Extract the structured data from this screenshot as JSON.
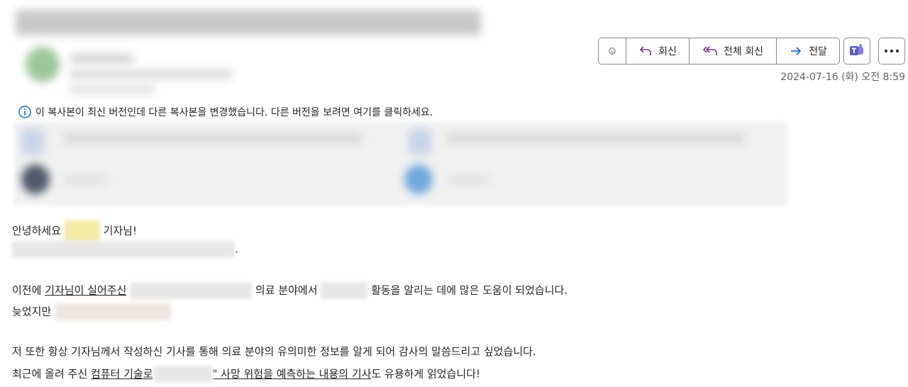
{
  "toolbar": {
    "reply_label": "회신",
    "reply_all_label": "전체 회신",
    "forward_label": "전달"
  },
  "message": {
    "date": "2024-07-16 (화) 오전 8:59",
    "info_text": "이 복사본이 최신 버전인데 다른 복사본을 변경했습니다. 다른 버전을 보려면 여기를 클릭하세요."
  },
  "body": {
    "greeting_prefix": "안녕하세요",
    "greeting_suffix": "기자님!",
    "line2_end": ".",
    "p1_a": "이전에",
    "p1_link": "기자님이 실어주신",
    "p1_b": "의료 분야에서",
    "p1_c": "활동을 알리는 데에 많은 도움이 되었습니다.",
    "p2_a": "늦었지만",
    "p3": "저 또한 항상 기자님께서 작성하신 기사를 통해 의료 분야의 유의미한 정보를 알게 되어 감사의 말씀드리고 싶었습니다.",
    "p4_a": "최근에 올려 주신",
    "p4_link1": "컴퓨터 기술로",
    "p4_link2": "\" 사망 위험을 예측하는 내용의 기사",
    "p4_b": "도 유용하게 읽었습니다!"
  },
  "colors": {
    "accent_purple": "#7a2e8e",
    "info_blue": "#0f6cbd",
    "forward_blue": "#0f6cbd",
    "teams_purple": "#5b5fc7"
  }
}
